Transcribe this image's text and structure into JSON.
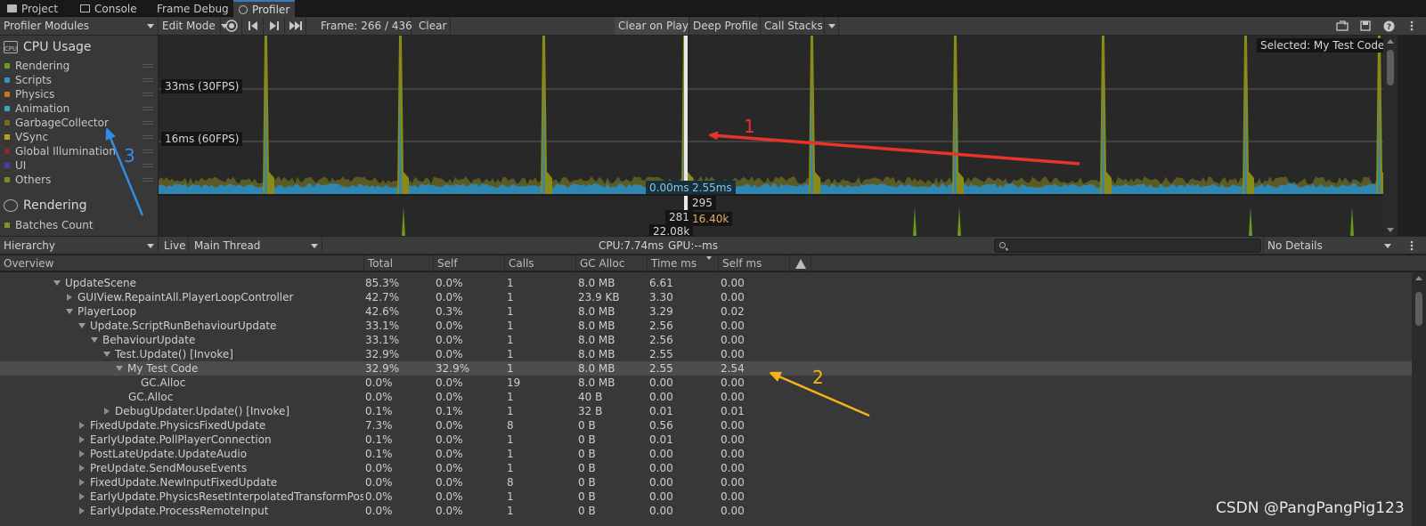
{
  "tabs": [
    {
      "label": "Project",
      "icon": "folder-icon"
    },
    {
      "label": "Console",
      "icon": "console-icon"
    },
    {
      "label": "Frame Debug",
      "icon": ""
    },
    {
      "label": "Profiler",
      "icon": "profiler-icon",
      "active": true
    }
  ],
  "toolbar": {
    "modules_dropdown": "Profiler Modules",
    "mode_dropdown": "Edit Mode",
    "frame_label": "Frame: 266 / 436",
    "clear": "Clear",
    "clear_on_play": "Clear on Play",
    "deep_profile": "Deep Profile",
    "call_stacks": "Call Stacks"
  },
  "cpu_module": {
    "title": "CPU Usage",
    "icon_text": "CPU",
    "legend": [
      {
        "label": "Rendering",
        "color": "#6a9a1f"
      },
      {
        "label": "Scripts",
        "color": "#3a8fbf"
      },
      {
        "label": "Physics",
        "color": "#c8731f"
      },
      {
        "label": "Animation",
        "color": "#3aa4c4"
      },
      {
        "label": "GarbageCollector",
        "color": "#7a6a1f"
      },
      {
        "label": "VSync",
        "color": "#b2a21a"
      },
      {
        "label": "Global Illumination",
        "color": "#8a2a2a"
      },
      {
        "label": "UI",
        "color": "#4a3aa8"
      },
      {
        "label": "Others",
        "color": "#7a8a2a"
      }
    ]
  },
  "rendering_module": {
    "title": "Rendering",
    "legend": [
      {
        "label": "Batches Count",
        "color": "#7a9a1f"
      }
    ]
  },
  "chart": {
    "line_30fps": "33ms (30FPS)",
    "line_60fps": "16ms (60FPS)",
    "selected": "Selected: My Test Code",
    "value_a": "0.00ms",
    "value_b": "2.55ms",
    "render_a": "295",
    "render_b": "281",
    "render_c": "16.40k",
    "render_d": "22.08k"
  },
  "hierarchy_bar": {
    "view": "Hierarchy",
    "live": "Live",
    "thread": "Main Thread",
    "cpu": "CPU:7.74ms",
    "gpu": "GPU:--ms",
    "details": "No Details"
  },
  "table": {
    "columns": [
      "Overview",
      "Total",
      "Self",
      "Calls",
      "GC Alloc",
      "Time ms",
      "Self ms"
    ],
    "rows": [
      {
        "name": "UpdateScene",
        "depth": 0,
        "toggle": "open",
        "total": "85.3%",
        "self": "0.0%",
        "calls": "1",
        "gc": "8.0 MB",
        "time": "6.61",
        "selfms": "0.00"
      },
      {
        "name": "GUIView.RepaintAll.PlayerLoopController",
        "depth": 1,
        "toggle": "closed",
        "total": "42.7%",
        "self": "0.0%",
        "calls": "1",
        "gc": "23.9 KB",
        "time": "3.30",
        "selfms": "0.00"
      },
      {
        "name": "PlayerLoop",
        "depth": 1,
        "toggle": "open",
        "total": "42.6%",
        "self": "0.3%",
        "calls": "1",
        "gc": "8.0 MB",
        "time": "3.29",
        "selfms": "0.02"
      },
      {
        "name": "Update.ScriptRunBehaviourUpdate",
        "depth": 2,
        "toggle": "open",
        "total": "33.1%",
        "self": "0.0%",
        "calls": "1",
        "gc": "8.0 MB",
        "time": "2.56",
        "selfms": "0.00"
      },
      {
        "name": "BehaviourUpdate",
        "depth": 3,
        "toggle": "open",
        "total": "33.1%",
        "self": "0.0%",
        "calls": "1",
        "gc": "8.0 MB",
        "time": "2.56",
        "selfms": "0.00"
      },
      {
        "name": "Test.Update() [Invoke]",
        "depth": 4,
        "toggle": "open",
        "total": "32.9%",
        "self": "0.0%",
        "calls": "1",
        "gc": "8.0 MB",
        "time": "2.55",
        "selfms": "0.00"
      },
      {
        "name": "My Test Code",
        "depth": 5,
        "toggle": "open",
        "selected": true,
        "total": "32.9%",
        "self": "32.9%",
        "calls": "1",
        "gc": "8.0 MB",
        "time": "2.55",
        "selfms": "2.54"
      },
      {
        "name": "GC.Alloc",
        "depth": 6,
        "toggle": "none",
        "total": "0.0%",
        "self": "0.0%",
        "calls": "19",
        "gc": "8.0 MB",
        "time": "0.00",
        "selfms": "0.00"
      },
      {
        "name": "GC.Alloc",
        "depth": 5,
        "toggle": "none",
        "total": "0.0%",
        "self": "0.0%",
        "calls": "1",
        "gc": "40 B",
        "time": "0.00",
        "selfms": "0.00"
      },
      {
        "name": "DebugUpdater.Update() [Invoke]",
        "depth": 4,
        "toggle": "closed",
        "total": "0.1%",
        "self": "0.1%",
        "calls": "1",
        "gc": "32 B",
        "time": "0.01",
        "selfms": "0.01"
      },
      {
        "name": "FixedUpdate.PhysicsFixedUpdate",
        "depth": 2,
        "toggle": "closed",
        "total": "7.3%",
        "self": "0.0%",
        "calls": "8",
        "gc": "0 B",
        "time": "0.56",
        "selfms": "0.00"
      },
      {
        "name": "EarlyUpdate.PollPlayerConnection",
        "depth": 2,
        "toggle": "closed",
        "total": "0.1%",
        "self": "0.0%",
        "calls": "1",
        "gc": "0 B",
        "time": "0.01",
        "selfms": "0.00"
      },
      {
        "name": "PostLateUpdate.UpdateAudio",
        "depth": 2,
        "toggle": "closed",
        "total": "0.1%",
        "self": "0.0%",
        "calls": "1",
        "gc": "0 B",
        "time": "0.00",
        "selfms": "0.00"
      },
      {
        "name": "PreUpdate.SendMouseEvents",
        "depth": 2,
        "toggle": "closed",
        "total": "0.0%",
        "self": "0.0%",
        "calls": "1",
        "gc": "0 B",
        "time": "0.00",
        "selfms": "0.00"
      },
      {
        "name": "FixedUpdate.NewInputFixedUpdate",
        "depth": 2,
        "toggle": "closed",
        "total": "0.0%",
        "self": "0.0%",
        "calls": "8",
        "gc": "0 B",
        "time": "0.00",
        "selfms": "0.00"
      },
      {
        "name": "EarlyUpdate.PhysicsResetInterpolatedTransformPositi",
        "depth": 2,
        "toggle": "closed",
        "total": "0.0%",
        "self": "0.0%",
        "calls": "1",
        "gc": "0 B",
        "time": "0.00",
        "selfms": "0.00"
      },
      {
        "name": "EarlyUpdate.ProcessRemoteInput",
        "depth": 2,
        "toggle": "closed",
        "total": "0.0%",
        "self": "0.0%",
        "calls": "1",
        "gc": "0 B",
        "time": "0.00",
        "selfms": "0.00"
      }
    ]
  },
  "annotations": {
    "a1": "1",
    "a2": "2",
    "a3": "3",
    "color_red": "#e8332a",
    "color_orange": "#f5b21a",
    "color_blue": "#2e8fe8"
  },
  "watermark": "CSDN @PangPangPig123"
}
